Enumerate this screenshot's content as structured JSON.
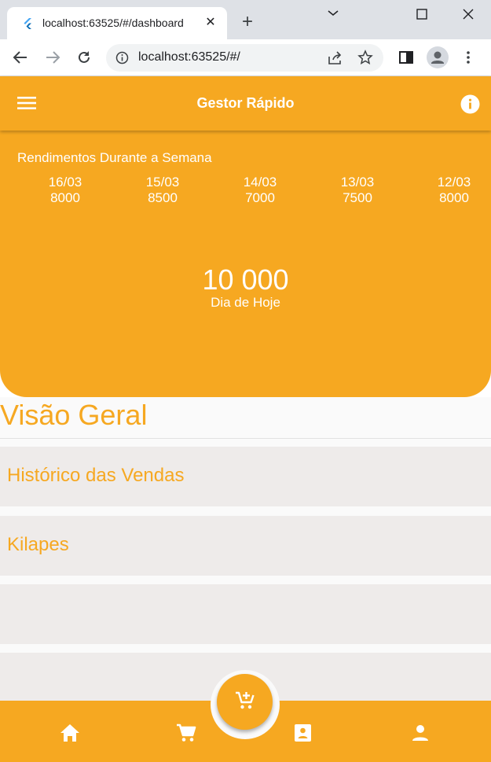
{
  "browser": {
    "tab_title": "localhost:63525/#/dashboard",
    "url": "localhost:63525/#/"
  },
  "app": {
    "title": "Gestor Rápido",
    "accent_color": "#f6a821"
  },
  "weekly": {
    "heading": "Rendimentos Durante a Semana",
    "days": [
      {
        "date": "16/03",
        "value": "8000"
      },
      {
        "date": "15/03",
        "value": "8500"
      },
      {
        "date": "14/03",
        "value": "7000"
      },
      {
        "date": "13/03",
        "value": "7500"
      },
      {
        "date": "12/03",
        "value": "8000"
      }
    ]
  },
  "today": {
    "value": "10 000",
    "caption": "Dia de Hoje"
  },
  "overview": {
    "title": "Visão Geral",
    "cards": [
      {
        "label": "Histórico das Vendas"
      },
      {
        "label": "Kilapes"
      },
      {
        "label": ""
      },
      {
        "label": ""
      }
    ]
  },
  "bottom_nav": {
    "items": [
      "home-icon",
      "cart-icon",
      "contact-book-icon",
      "person-icon"
    ],
    "fab_icon": "add-cart-icon"
  }
}
